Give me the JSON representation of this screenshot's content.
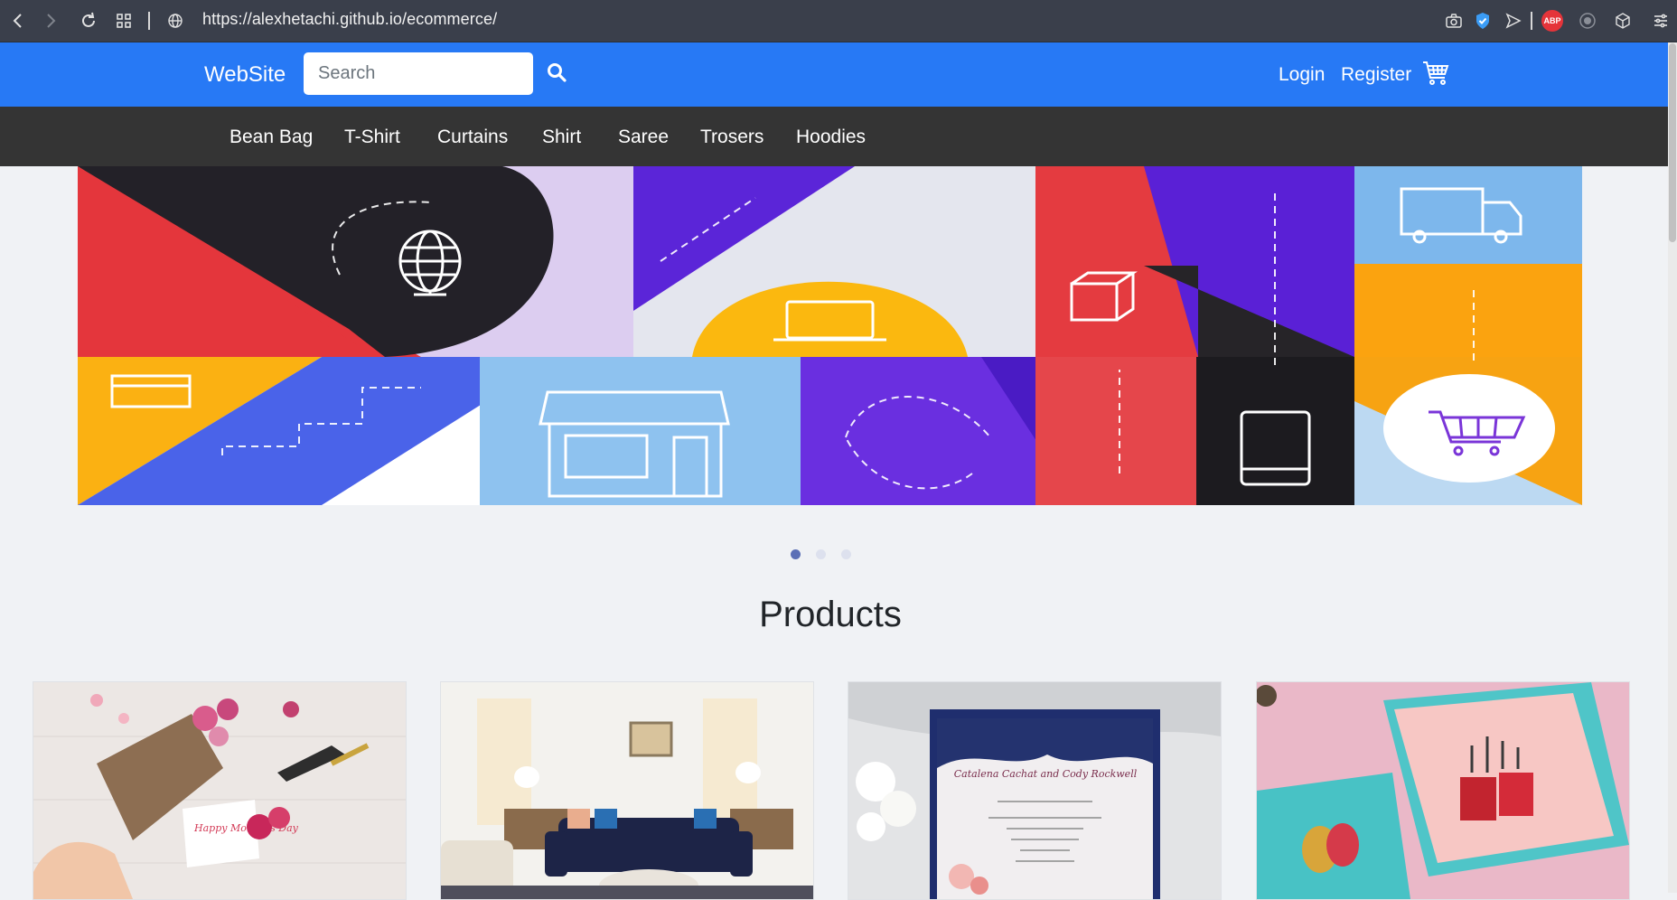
{
  "browser": {
    "url": "https://alexhetachi.github.io/ecommerce/",
    "icons": [
      "back-icon",
      "forward-icon",
      "reload-icon",
      "tabs-grid-icon",
      "globe-icon",
      "camera-icon",
      "shield-icon",
      "send-icon",
      "abp-icon",
      "record-icon",
      "cube-icon",
      "menu-icon"
    ],
    "abp_label": "ABP"
  },
  "header": {
    "brand": "WebSite",
    "search_placeholder": "Search",
    "login": "Login",
    "register": "Register",
    "color": "#2779f5"
  },
  "categories": [
    "Bean Bag",
    "T-Shirt",
    "Curtains",
    "Shirt",
    "Saree",
    "Trosers",
    "Hoodies"
  ],
  "carousel": {
    "slide_count": 3,
    "active_slide": 1
  },
  "products": {
    "title": "Products",
    "cards": [
      {
        "image": "mothers-day-flowers-image"
      },
      {
        "image": "living-room-image"
      },
      {
        "image": "wedding-invitation-image"
      },
      {
        "image": "birthday-card-image"
      }
    ],
    "card1_text": "Happy Mother's Day",
    "card3_names": "Catalena Cachat and Cody Rockwell"
  }
}
